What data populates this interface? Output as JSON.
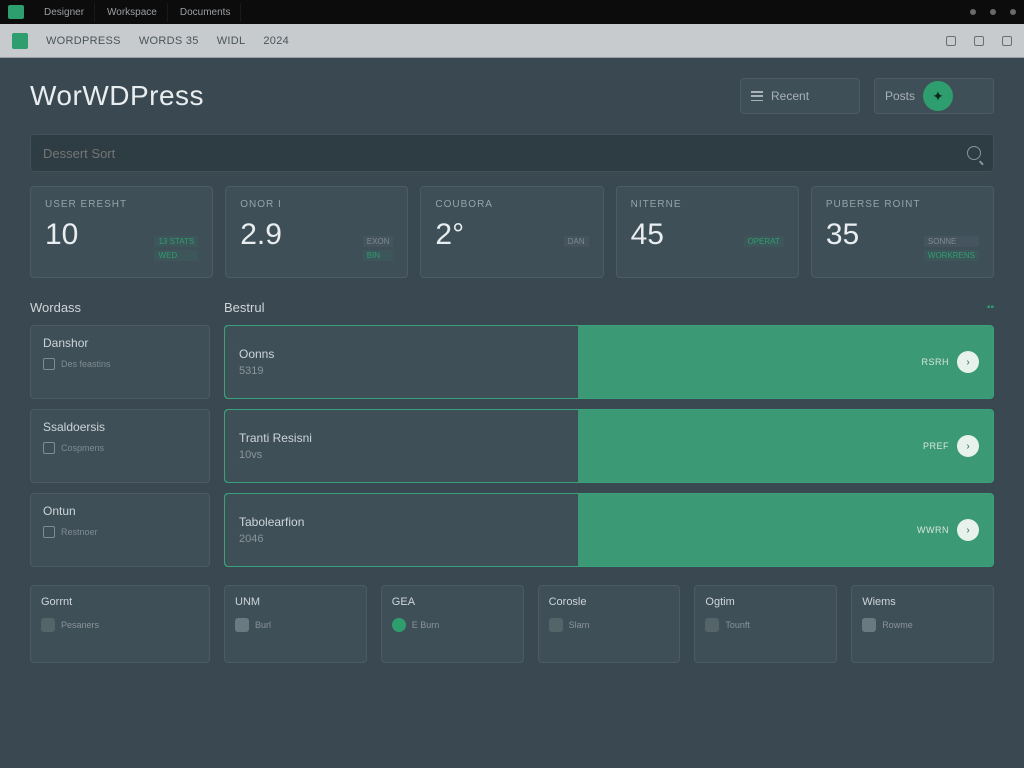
{
  "tabstrip": {
    "tabs": [
      "Designer",
      "Workspace",
      "Documents"
    ]
  },
  "toolbar": {
    "brand": "WORDPRESS",
    "items": [
      "WORDS 35",
      "WIDL",
      "2024"
    ]
  },
  "header": {
    "title": "WorWDPress",
    "select1": "Recent",
    "select2": "Posts"
  },
  "search": {
    "placeholder": "Dessert Sort"
  },
  "stats": [
    {
      "label": "USER ERESHT",
      "value": "10",
      "chips": [
        "13 STATS",
        "WED"
      ]
    },
    {
      "label": "ONOR I",
      "value": "2.9",
      "chips": [
        "EXON",
        "BIN"
      ]
    },
    {
      "label": "COUBORA",
      "value": "2°",
      "chips": [
        "",
        "DAN"
      ]
    },
    {
      "label": "NITERNE",
      "value": "45",
      "chips": [
        "OPERAT",
        ""
      ]
    },
    {
      "label": "PUBERSE ROINT",
      "value": "35",
      "chips": [
        "SONNE",
        "WORKRENS"
      ]
    }
  ],
  "sidehead": "Wordass",
  "barhead": "Bestrul",
  "sidecards": [
    {
      "title": "Danshor",
      "sub": "Des feastins",
      "icon": "flag"
    },
    {
      "title": "Ssaldoersis",
      "sub": "Cospmens",
      "icon": "calendar"
    },
    {
      "title": "Ontun",
      "sub": "Restnoer",
      "icon": "card"
    }
  ],
  "bars": [
    {
      "title": "Oonns",
      "sub": "5319",
      "tag": "RSRH"
    },
    {
      "title": "Tranti Resisni",
      "sub": "10vs",
      "tag": "PREF"
    },
    {
      "title": "Tabolearfion",
      "sub": "2046",
      "tag": "WWRN"
    }
  ],
  "bcols": [
    {
      "h": "Gorrnt",
      "t": "Pesaners",
      "icon": "box"
    },
    {
      "h": "UNM",
      "t": "Burl",
      "icon": "shield"
    },
    {
      "h": "GEA",
      "t": "E Burn",
      "icon": "green"
    },
    {
      "h": "Corosle",
      "t": "Slarn",
      "icon": "box"
    },
    {
      "h": "Ogtim",
      "t": "Tounft",
      "icon": "box"
    },
    {
      "h": "Wiems",
      "t": "Rowme",
      "icon": "shield"
    }
  ],
  "colors": {
    "accent": "#2e9e6f"
  }
}
